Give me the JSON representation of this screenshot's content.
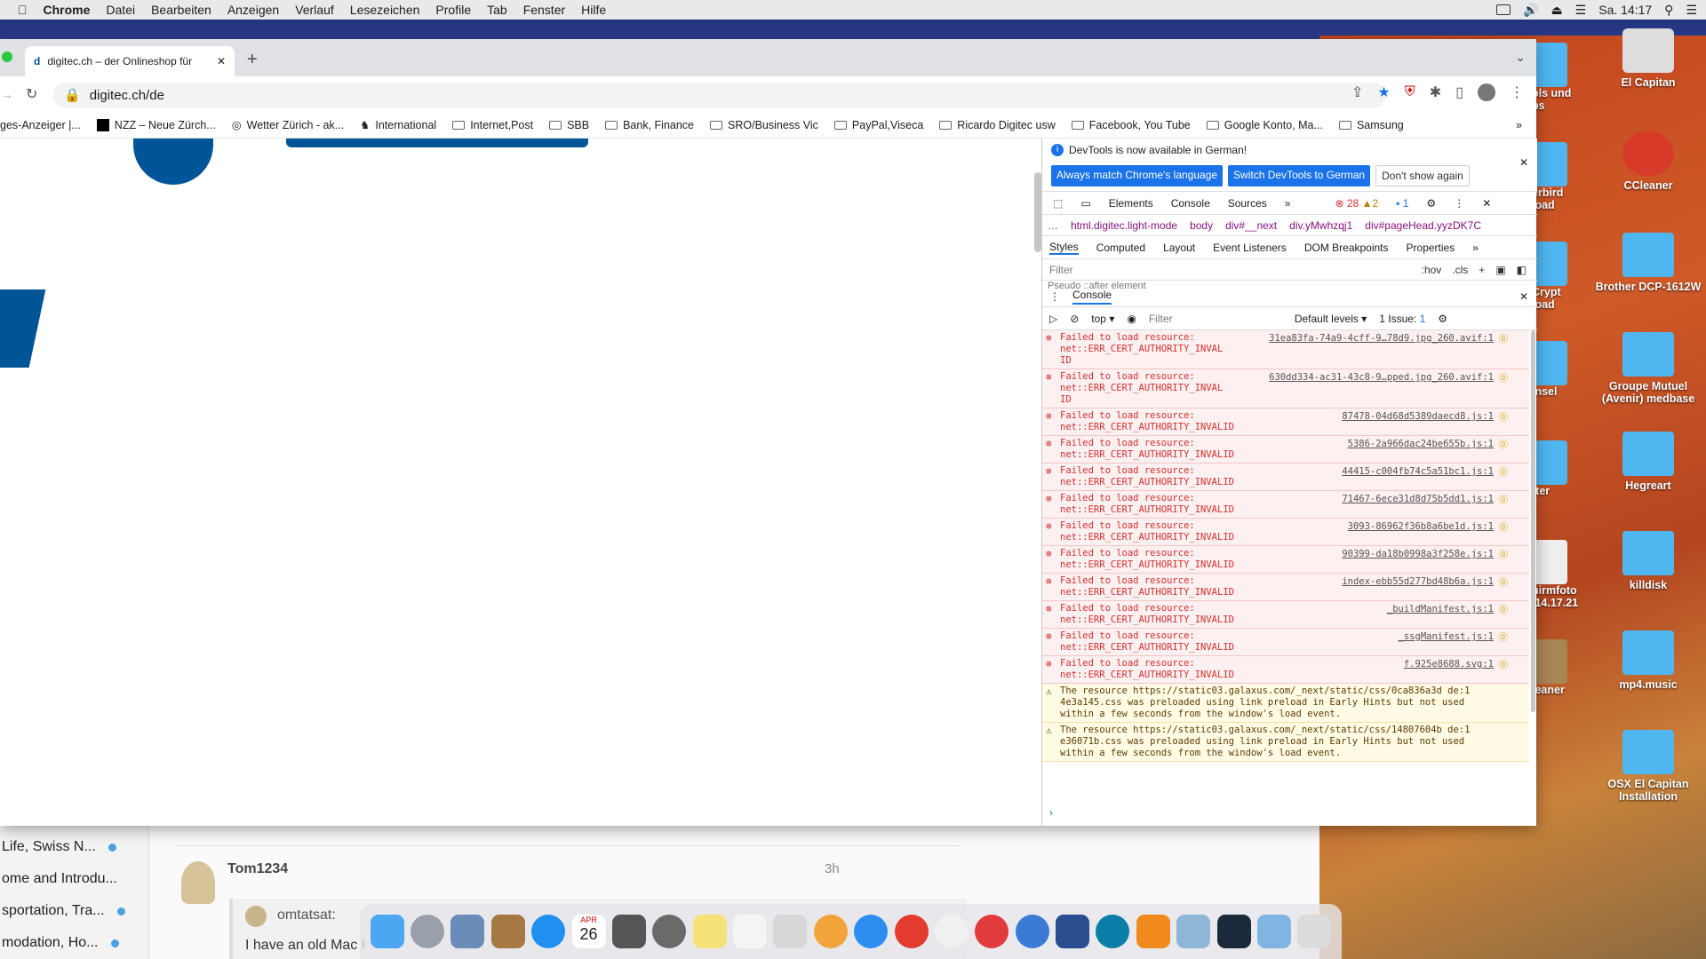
{
  "menubar": {
    "app": "Chrome",
    "items": [
      "Datei",
      "Bearbeiten",
      "Anzeigen",
      "Verlauf",
      "Lesezeichen",
      "Profile",
      "Tab",
      "Fenster",
      "Hilfe"
    ],
    "clock": "Sa. 14:17"
  },
  "browser": {
    "tab_title": "digitec.ch – der Onlineshop für",
    "url": "digitec.ch/de",
    "bookmarks": [
      "ges-Anzeiger |...",
      "NZZ – Neue Zürch...",
      "Wetter Zürich - ak...",
      "International",
      "Internet,Post",
      "SBB",
      "Bank, Finance",
      "SRO/Business Vic",
      "PayPal,Viseca",
      "Ricardo Digitec usw",
      "Facebook, You Tube",
      "Google Konto, Ma...",
      "Samsung"
    ]
  },
  "devtools": {
    "banner_text": "DevTools is now available in German!",
    "btn_match": "Always match Chrome's language",
    "btn_switch": "Switch DevTools to German",
    "btn_dismiss": "Don't show again",
    "tabs": [
      "Elements",
      "Console",
      "Sources"
    ],
    "error_count": "28",
    "warn_count": "2",
    "msg_count": "1",
    "breadcrumbs": [
      "html.digitec.light-mode",
      "body",
      "div#__next",
      "div.yMwhzqj1",
      "div#pageHead.yyzDK7C"
    ],
    "subtabs": [
      "Styles",
      "Computed",
      "Layout",
      "Event Listeners",
      "DOM Breakpoints",
      "Properties"
    ],
    "styles_filter": "Filter",
    "hov": ":hov",
    "cls": ".cls",
    "pseudo_label": "Pseudo ::after element",
    "console_tab": "Console",
    "context": "top",
    "console_filter": "Filter",
    "levels": "Default levels",
    "issues": "1 Issue:",
    "issues_count": "1"
  },
  "console": [
    {
      "type": "err",
      "msg": "Failed to load resource:\nnet::ERR_CERT_AUTHORITY_INVAL\nID",
      "src": "31ea83fa-74a9-4cff-9…78d9.jpg_260.avif:1"
    },
    {
      "type": "err",
      "msg": "Failed to load resource:\nnet::ERR_CERT_AUTHORITY_INVAL\nID",
      "src": "630dd334-ac31-43c8-9…pped.jpg_260.avif:1"
    },
    {
      "type": "err",
      "msg": "Failed to load resource:\nnet::ERR_CERT_AUTHORITY_INVALID",
      "src": "87478-04d68d5389daecd8.js:1"
    },
    {
      "type": "err",
      "msg": "Failed to load resource:\nnet::ERR_CERT_AUTHORITY_INVALID",
      "src": "5386-2a966dac24be655b.js:1"
    },
    {
      "type": "err",
      "msg": "Failed to load resource:\nnet::ERR_CERT_AUTHORITY_INVALID",
      "src": "44415-c004fb74c5a51bc1.js:1"
    },
    {
      "type": "err",
      "msg": "Failed to load resource:\nnet::ERR_CERT_AUTHORITY_INVALID",
      "src": "71467-6ece31d8d75b5dd1.js:1"
    },
    {
      "type": "err",
      "msg": "Failed to load resource:\nnet::ERR_CERT_AUTHORITY_INVALID",
      "src": "3093-86962f36b8a6be1d.js:1"
    },
    {
      "type": "err",
      "msg": "Failed to load resource:\nnet::ERR_CERT_AUTHORITY_INVALID",
      "src": "90399-da18b0998a3f258e.js:1"
    },
    {
      "type": "err",
      "msg": "Failed to load resource:\nnet::ERR_CERT_AUTHORITY_INVALID",
      "src": "index-ebb55d277bd48b6a.js:1"
    },
    {
      "type": "err",
      "msg": "Failed to load resource:\nnet::ERR_CERT_AUTHORITY_INVALID",
      "src": "_buildManifest.js:1"
    },
    {
      "type": "err",
      "msg": "Failed to load resource:\nnet::ERR_CERT_AUTHORITY_INVALID",
      "src": "_ssgManifest.js:1"
    },
    {
      "type": "err",
      "msg": "Failed to load resource:\nnet::ERR_CERT_AUTHORITY_INVALID",
      "src": "f.925e8688.svg:1"
    },
    {
      "type": "warn",
      "msg": "The resource https://static03.galaxus.com/_next/static/css/0ca836a3d de:1\n4e3a145.css was preloaded using link preload in Early Hints but not used\nwithin a few seconds from the window's load event.",
      "src": ""
    },
    {
      "type": "warn",
      "msg": "The resource https://static03.galaxus.com/_next/static/css/14807604b de:1\ne36071b.css was preloaded using link preload in Early Hints but not used\nwithin a few seconds from the window's load event.",
      "src": ""
    }
  ],
  "lower_window": {
    "side_items": [
      "Life, Swiss N...",
      "ome and Introdu...",
      "sportation, Tra...",
      "modation, Ho..."
    ],
    "author": "Tom1234",
    "time": "3h",
    "quote_author": "omtatsat:",
    "quote_text": "I have an old Mac I"
  },
  "desktop_icons": [
    "El Capitan",
    "CCleaner",
    "Brother DCP-1612W",
    "Groupe Mutuel (Avenir) medbase",
    "Hegreart",
    "killdisk",
    "mp4.music",
    "OSX El Capitan Installation"
  ],
  "desktop_partial_labels": [
    "ols und\nps",
    "erbird\nload",
    "Crypt\nload",
    "Insel",
    "tter",
    "hirmfoto\n.14.17.21",
    "leaner"
  ],
  "dock_calendar": {
    "month": "APR",
    "day": "26"
  }
}
